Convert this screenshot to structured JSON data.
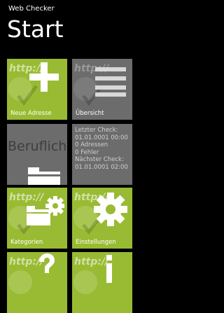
{
  "app": {
    "name": "Web Checker"
  },
  "page": {
    "title": "Start"
  },
  "tiles": {
    "watermark": "http://",
    "new_address": {
      "label": "Neue Adresse"
    },
    "overview": {
      "label": "Übersicht"
    },
    "business": {
      "text": "Beruflich"
    },
    "status": {
      "lines": [
        "Letzter Check:",
        "01.01.0001 00:00",
        "0 Adressen",
        "0 Fehler",
        "Nächster Check:",
        "01.01.0001 02:00"
      ]
    },
    "categories": {
      "label": "Kategorien"
    },
    "settings": {
      "label": "Einstellungen"
    }
  },
  "colors": {
    "background": "#000000",
    "tile_green": "#99bb33",
    "tile_gray": "#6c6c6c",
    "text": "#ffffff"
  },
  "icons": [
    "plus-icon",
    "list-icon",
    "folder-icon",
    "folder-gear-icon",
    "gear-icon",
    "question-icon",
    "info-icon",
    "globe-check-icon"
  ]
}
